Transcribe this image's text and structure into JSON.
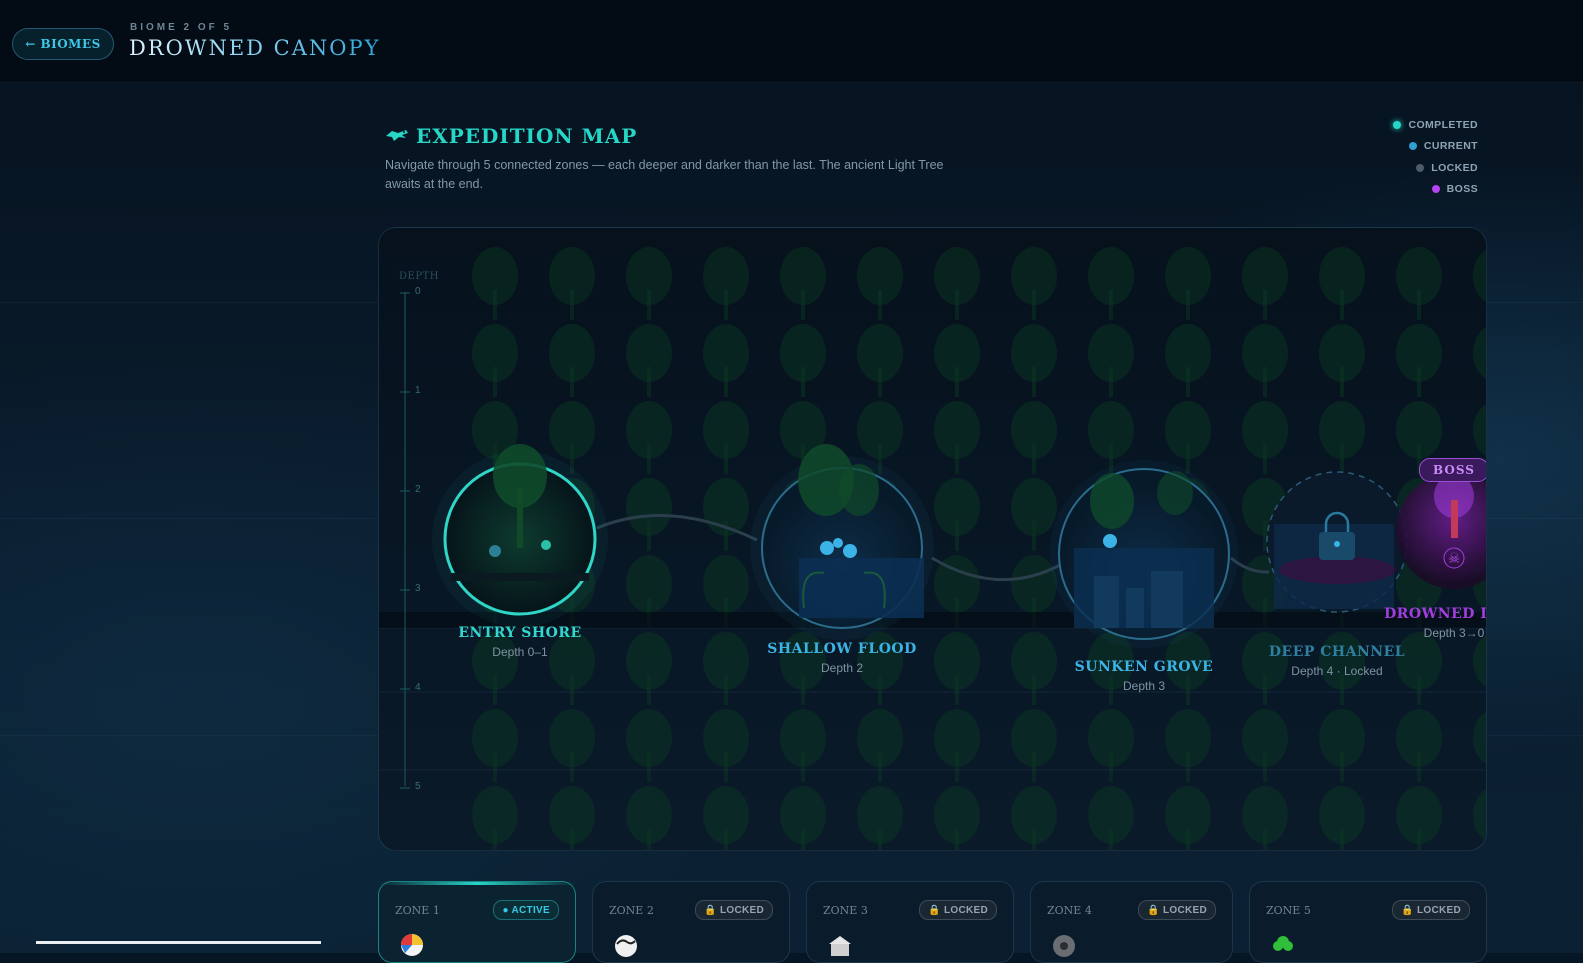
{
  "header": {
    "back_label": "← BIOMES",
    "kicker": "BIOME 2 OF 5",
    "title": "DROWNED CANOPY"
  },
  "map": {
    "title": "EXPEDITION MAP",
    "description": "Navigate through 5 connected zones — each deeper and darker than the last. The ancient Light Tree awaits at the end.",
    "depth_axis_label": "DEPTH",
    "depth_ticks": [
      "0",
      "1",
      "2",
      "3",
      "4",
      "5"
    ]
  },
  "legend": [
    {
      "label": "COMPLETED",
      "color": "#26d6c6"
    },
    {
      "label": "CURRENT",
      "color": "#2f9fd0"
    },
    {
      "label": "LOCKED",
      "color": "#4e5c68"
    },
    {
      "label": "BOSS",
      "color": "#b445f0"
    }
  ],
  "zones": [
    {
      "name": "ENTRY SHORE",
      "depth": "Depth 0–1",
      "color": "#34d6d0"
    },
    {
      "name": "SHALLOW FLOOD",
      "depth": "Depth 2",
      "color": "#3cb3e6"
    },
    {
      "name": "SUNKEN GROVE",
      "depth": "Depth 3",
      "color": "#3cb3e6"
    },
    {
      "name": "DEEP CHANNEL",
      "depth": "Depth 4 · Locked",
      "color": "#2f7fa0"
    },
    {
      "name": "DROWNED LIGH",
      "depth": "Depth 3→0",
      "color": "#a23ee0",
      "boss_tag": "BOSS"
    }
  ],
  "cards": [
    {
      "zone": "ZONE 1",
      "status": "● ACTIVE",
      "state": "active"
    },
    {
      "zone": "ZONE 2",
      "status": "🔒 LOCKED",
      "state": "locked"
    },
    {
      "zone": "ZONE 3",
      "status": "🔒 LOCKED",
      "state": "locked"
    },
    {
      "zone": "ZONE 4",
      "status": "🔒 LOCKED",
      "state": "locked"
    },
    {
      "zone": "ZONE 5",
      "status": "🔒 LOCKED",
      "state": "locked"
    }
  ]
}
